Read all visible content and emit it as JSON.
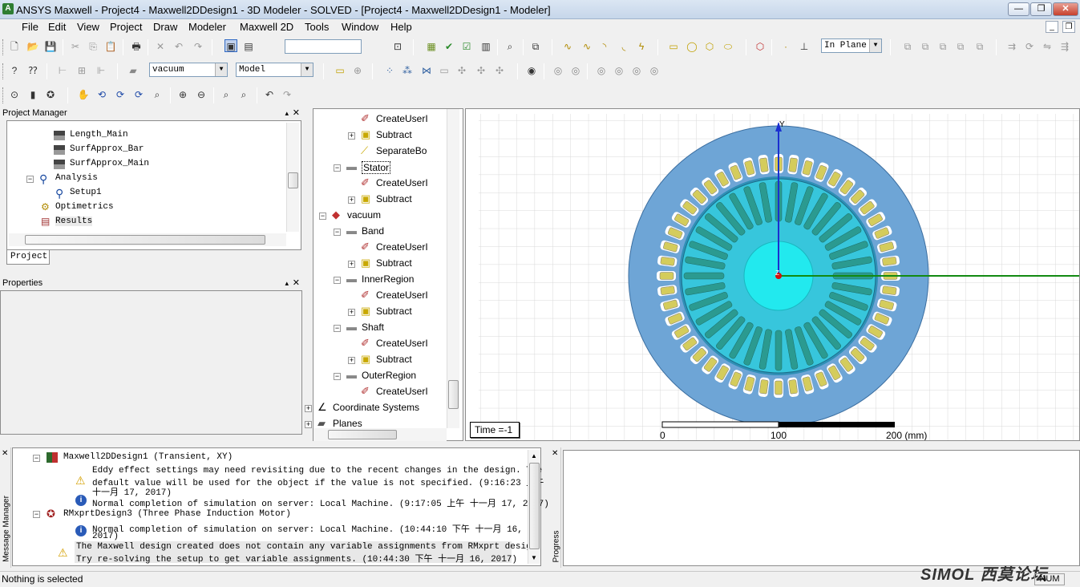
{
  "window": {
    "title": "ANSYS Maxwell - Project4 - Maxwell2DDesign1 - 3D Modeler - SOLVED - [Project4 - Maxwell2DDesign1 - Modeler]"
  },
  "menu": [
    "File",
    "Edit",
    "View",
    "Project",
    "Draw",
    "Modeler",
    "Maxwell 2D",
    "Tools",
    "Window",
    "Help"
  ],
  "toolbar": {
    "material_combo": "vacuum",
    "model_combo": "Model",
    "plane_combo": "In Plane",
    "blank_combo": ""
  },
  "project_manager": {
    "title": "Project Manager",
    "tab": "Project",
    "items": [
      {
        "label": "Length_Main"
      },
      {
        "label": "SurfApprox_Bar"
      },
      {
        "label": "SurfApprox_Main"
      },
      {
        "label": "Analysis"
      },
      {
        "label": "Setup1"
      },
      {
        "label": "Optimetrics"
      },
      {
        "label": "Results"
      }
    ]
  },
  "properties": {
    "title": "Properties"
  },
  "history_tree": {
    "items": [
      {
        "label": "CreateUserI"
      },
      {
        "label": "Subtract"
      },
      {
        "label": "SeparateBo"
      },
      {
        "label": "Stator"
      },
      {
        "label": "CreateUserI"
      },
      {
        "label": "Subtract"
      },
      {
        "label": "vacuum"
      },
      {
        "label": "Band"
      },
      {
        "label": "CreateUserI"
      },
      {
        "label": "Subtract"
      },
      {
        "label": "InnerRegion"
      },
      {
        "label": "CreateUserI"
      },
      {
        "label": "Subtract"
      },
      {
        "label": "Shaft"
      },
      {
        "label": "CreateUserI"
      },
      {
        "label": "Subtract"
      },
      {
        "label": "OuterRegion"
      },
      {
        "label": "CreateUserI"
      },
      {
        "label": "Coordinate Systems"
      },
      {
        "label": "Planes"
      }
    ]
  },
  "modeler": {
    "time_label": "Time =-1",
    "axis_y": "Y",
    "axis_z": "Z",
    "scale": {
      "left": "0",
      "mid": "100",
      "right": "200 (mm)"
    },
    "colors": {
      "stator": "#6ea5d6",
      "rotor": "#37c6dc",
      "shaft": "#22e9ee",
      "coil": "#d4cc5c",
      "bar": "#2b9a90"
    }
  },
  "messages": {
    "panel_label": "Message Manager",
    "lines": [
      {
        "text": "Maxwell2DDesign1 (Transient, XY)"
      },
      {
        "text": "Eddy effect settings may need revisiting due to the recent changes in the design.  The"
      },
      {
        "text": "default value will be used for the object if the value is not specified.  (9:16:23 上午"
      },
      {
        "text": "十一月 17, 2017)"
      },
      {
        "text": "Normal completion of simulation on server: Local Machine. (9:17:05 上午  十一月 17, 2017)"
      },
      {
        "text": "RMxprtDesign3 (Three Phase Induction Motor)"
      },
      {
        "text": "Normal completion of simulation on server: Local Machine. (10:44:10 下午  十一月 16,"
      },
      {
        "text": "2017)"
      },
      {
        "text": "The Maxwell design created does not contain any variable assignments from RMxprt design."
      },
      {
        "text": "Try re-solving the setup to get variable assignments. (10:44:30 下午  十一月 16, 2017)"
      }
    ]
  },
  "progress": {
    "panel_label": "Progress"
  },
  "status": {
    "text": "Nothing is selected",
    "num": "NUM",
    "watermark": "SIMOL 西莫论坛"
  }
}
